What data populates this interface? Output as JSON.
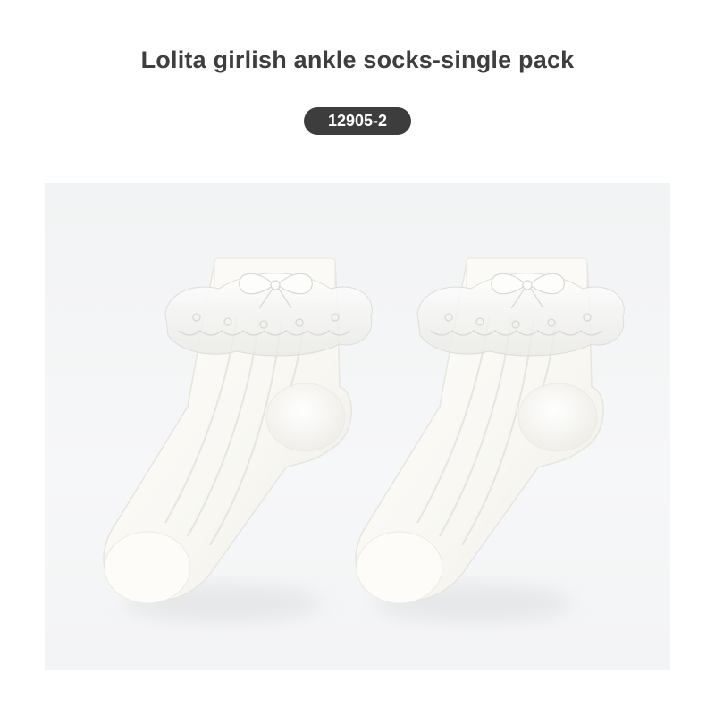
{
  "product": {
    "title": "Lolita girlish ankle socks-single pack",
    "sku": "12905-2"
  },
  "photo": {
    "subject": "pair-of-white-lace-ruffle-ankle-socks",
    "sock_color": "#fbfaf6",
    "background_color": "#f3f4f5",
    "item_count": 2
  },
  "colors": {
    "title_text": "#3e3e3e",
    "badge_background": "#3d3d3d",
    "badge_text": "#ffffff"
  }
}
